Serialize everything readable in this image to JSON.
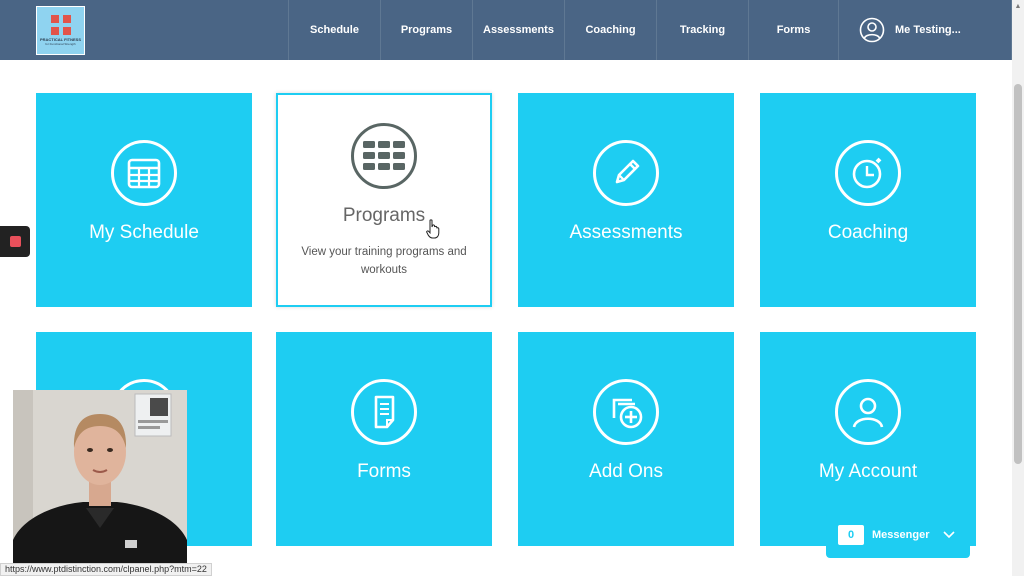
{
  "header": {
    "logo": {
      "name": "PRACTICAL FITNESS",
      "tagline": "for Functional Strength"
    },
    "nav": [
      {
        "label": "Schedule"
      },
      {
        "label": "Programs"
      },
      {
        "label": "Assessments"
      },
      {
        "label": "Coaching"
      },
      {
        "label": "Tracking"
      },
      {
        "label": "Forms"
      }
    ],
    "user": {
      "name": "Me Testing...",
      "icon": "user-circle-icon"
    }
  },
  "tiles": [
    {
      "label": "My Schedule",
      "icon": "calendar-icon"
    },
    {
      "label": "Programs",
      "icon": "grid-icon",
      "description": "View your training programs and workouts",
      "active": true
    },
    {
      "label": "Assessments",
      "icon": "pencil-icon"
    },
    {
      "label": "Coaching",
      "icon": "stopwatch-icon"
    },
    {
      "label": "",
      "icon": "clock-icon"
    },
    {
      "label": "Forms",
      "icon": "document-icon"
    },
    {
      "label": "Add Ons",
      "icon": "add-icon"
    },
    {
      "label": "My Account",
      "icon": "account-icon"
    }
  ],
  "messenger": {
    "count": "0",
    "label": "Messenger"
  },
  "status_url": "https://www.ptdistinction.com/clpanel.php?mtm=22",
  "colors": {
    "nav_bg": "#4a6585",
    "tile_bg": "#1ecdf2",
    "record": "#e8505b"
  }
}
